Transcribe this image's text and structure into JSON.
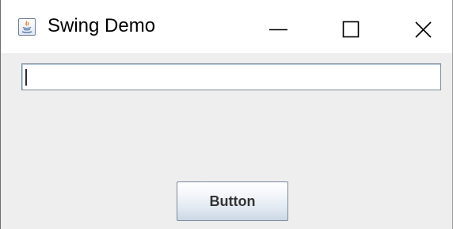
{
  "window": {
    "title": "Swing Demo",
    "app_icon": "java-cup-icon",
    "controls": {
      "minimize_icon": "minimize-icon",
      "maximize_icon": "maximize-icon",
      "close_icon": "close-icon"
    }
  },
  "content": {
    "text_field": {
      "value": "",
      "placeholder": ""
    },
    "button": {
      "label": "Button"
    }
  },
  "colors": {
    "content_background": "#eeeeee",
    "titlebar_background": "#ffffff",
    "field_border": "#7a8a99",
    "button_text": "#333333"
  }
}
